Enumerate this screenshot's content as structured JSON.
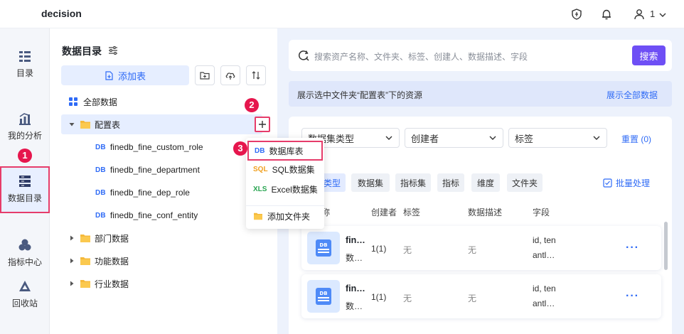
{
  "topbar": {
    "brand": "decision",
    "user_number": "1"
  },
  "leftnav": {
    "items": [
      {
        "label": "目录",
        "icon": "list-icon"
      },
      {
        "label": "我的分析",
        "icon": "analysis-chart-icon"
      },
      {
        "label": "数据目录",
        "icon": "data-catalog-icon",
        "active": true
      },
      {
        "label": "指标中心",
        "icon": "metric-center-icon"
      },
      {
        "label": "回收站",
        "icon": "recycle-bin-icon"
      }
    ]
  },
  "badges": [
    "1",
    "2",
    "3"
  ],
  "catalog": {
    "title": "数据目录",
    "add_table": "添加表",
    "tree": {
      "all": "全部数据",
      "config_folder": "配置表",
      "children": [
        "finedb_fine_custom_role",
        "finedb_fine_department",
        "finedb_fine_dep_role",
        "finedb_fine_conf_entity"
      ],
      "folders": [
        "部门数据",
        "功能数据",
        "行业数据"
      ]
    },
    "db_tag": "DB"
  },
  "dropdown": {
    "items": [
      {
        "icon_text": "DB",
        "label": "数据库表"
      },
      {
        "icon_text": "SQL",
        "label": "SQL数据集"
      },
      {
        "icon_text": "XLS",
        "label": "Excel数据集"
      },
      {
        "icon_text": "",
        "label": "添加文件夹"
      }
    ]
  },
  "main": {
    "search_placeholder": "搜索资产名称、文件夹、标签、创建人、数据描述、字段",
    "search_button": "搜索",
    "info_text": "展示选中文件夹“配置表”下的资源",
    "info_link": "展示全部数据",
    "filters": {
      "dataset_type": "数据集类型",
      "creator": "创建者",
      "tag": "标签",
      "reset": "重置 (0)"
    },
    "chips": [
      "全部类型",
      "数据集",
      "指标集",
      "指标",
      "维度",
      "文件夹"
    ],
    "batch": "批量处理",
    "table_headers": {
      "name": "名称",
      "creator": "创建者",
      "tag": "标签",
      "desc": "数据描述",
      "fields": "字段"
    },
    "rows": [
      {
        "name": "fin…",
        "sub": "数…",
        "creator": "1(1)",
        "tag": "无",
        "desc": "无",
        "fields1": "id, ten",
        "fields2": "antl…",
        "thumb": "DB",
        "more": "···"
      },
      {
        "name": "fin…",
        "sub": "数…",
        "creator": "1(1)",
        "tag": "无",
        "desc": "无",
        "fields1": "id, ten",
        "fields2": "antl…",
        "thumb": "DB",
        "more": "···"
      }
    ]
  },
  "colors": {
    "accent": "#2f6bf6",
    "search_button": "#6e4ff5",
    "highlight_border": "#e63c6a",
    "badge": "#e6164d",
    "folder": "#f5b93b"
  }
}
